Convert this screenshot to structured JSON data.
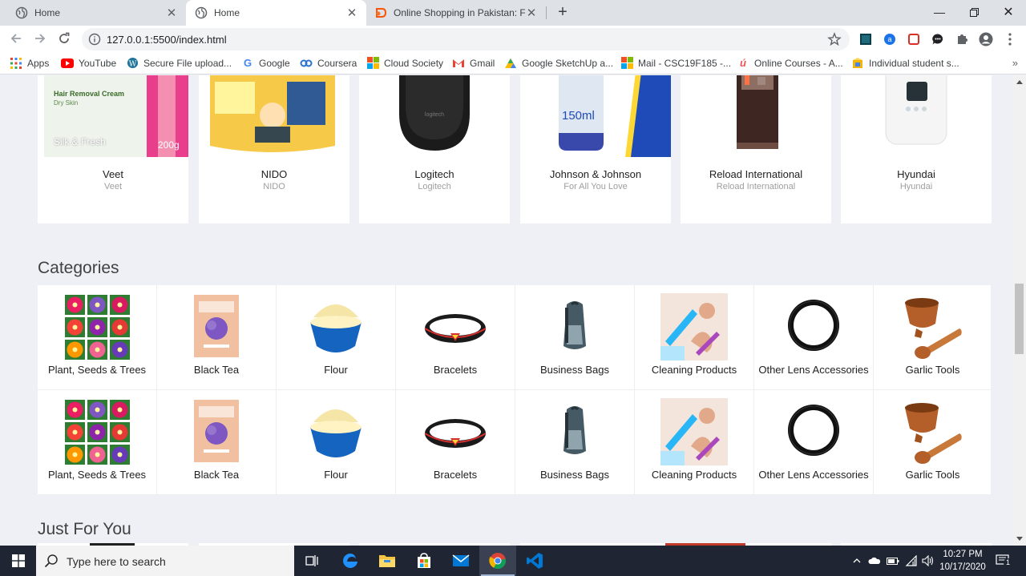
{
  "browser": {
    "tabs": [
      {
        "title": "Home",
        "active": false,
        "icon": "globe-icon"
      },
      {
        "title": "Home",
        "active": true,
        "icon": "globe-icon"
      },
      {
        "title": "Online Shopping in Pakistan: Fas",
        "active": false,
        "icon": "daraz-icon"
      }
    ],
    "url": "127.0.0.1:5500/index.html",
    "bookmarks": [
      {
        "label": "Apps",
        "icon": "apps-grid-icon"
      },
      {
        "label": "YouTube",
        "icon": "youtube-icon"
      },
      {
        "label": "Secure File upload...",
        "icon": "wordpress-icon"
      },
      {
        "label": "Google",
        "icon": "google-icon"
      },
      {
        "label": "Coursera",
        "icon": "coursera-icon"
      },
      {
        "label": "Cloud Society",
        "icon": "microsoft-icon"
      },
      {
        "label": "Gmail",
        "icon": "gmail-icon"
      },
      {
        "label": "Google SketchUp a...",
        "icon": "sketchup-icon"
      },
      {
        "label": "Mail - CSC19F185 -...",
        "icon": "microsoft-icon"
      },
      {
        "label": "Online Courses - A...",
        "icon": "udemy-icon"
      },
      {
        "label": "Individual student s...",
        "icon": "box-icon"
      }
    ],
    "bookmarks_more": "»"
  },
  "page": {
    "brands": [
      {
        "name": "Veet",
        "sub": "Veet",
        "image": "hair-removal-cream"
      },
      {
        "name": "NIDO",
        "sub": "NIDO",
        "image": "nido-milk-tin"
      },
      {
        "name": "Logitech",
        "sub": "Logitech",
        "image": "logitech-mouse",
        "image_text": "logitech"
      },
      {
        "name": "Johnson & Johnson",
        "sub": "For All You Love",
        "image": "lotion-tube",
        "image_text": "150ml"
      },
      {
        "name": "Reload International",
        "sub": "Reload International",
        "image": "protein-bar"
      },
      {
        "name": "Hyundai",
        "sub": "Hyundai",
        "image": "white-device"
      }
    ],
    "veet_image_text": {
      "line1": "Hair Removal Cream",
      "line2": "Dry Skin",
      "brand": "Silk & Fresh",
      "weight": "200g"
    },
    "categories_title": "Categories",
    "category_rows": [
      [
        {
          "label": "Plant, Seeds & Trees",
          "image": "flowers"
        },
        {
          "label": "Black Tea",
          "image": "tea-bag"
        },
        {
          "label": "Flour",
          "image": "flour-bowl"
        },
        {
          "label": "Bracelets",
          "image": "bracelet"
        },
        {
          "label": "Business Bags",
          "image": "backpack"
        },
        {
          "label": "Cleaning Products",
          "image": "cleaning"
        },
        {
          "label": "Other Lens Accessories",
          "image": "lens-ring"
        },
        {
          "label": "Garlic Tools",
          "image": "mortar-pestle"
        }
      ],
      [
        {
          "label": "Plant, Seeds & Trees",
          "image": "flowers"
        },
        {
          "label": "Black Tea",
          "image": "tea-bag"
        },
        {
          "label": "Flour",
          "image": "flour-bowl"
        },
        {
          "label": "Bracelets",
          "image": "bracelet"
        },
        {
          "label": "Business Bags",
          "image": "backpack"
        },
        {
          "label": "Cleaning Products",
          "image": "cleaning"
        },
        {
          "label": "Other Lens Accessories",
          "image": "lens-ring"
        },
        {
          "label": "Garlic Tools",
          "image": "mortar-pestle"
        }
      ]
    ],
    "just_for_you_title": "Just For You"
  },
  "taskbar": {
    "search_placeholder": "Type here to search",
    "time": "10:27 PM",
    "date": "10/17/2020",
    "notification_count": "1",
    "apps": [
      "task-view-icon",
      "edge-icon",
      "file-explorer-icon",
      "store-icon",
      "mail-icon",
      "chrome-icon",
      "vscode-icon"
    ]
  }
}
